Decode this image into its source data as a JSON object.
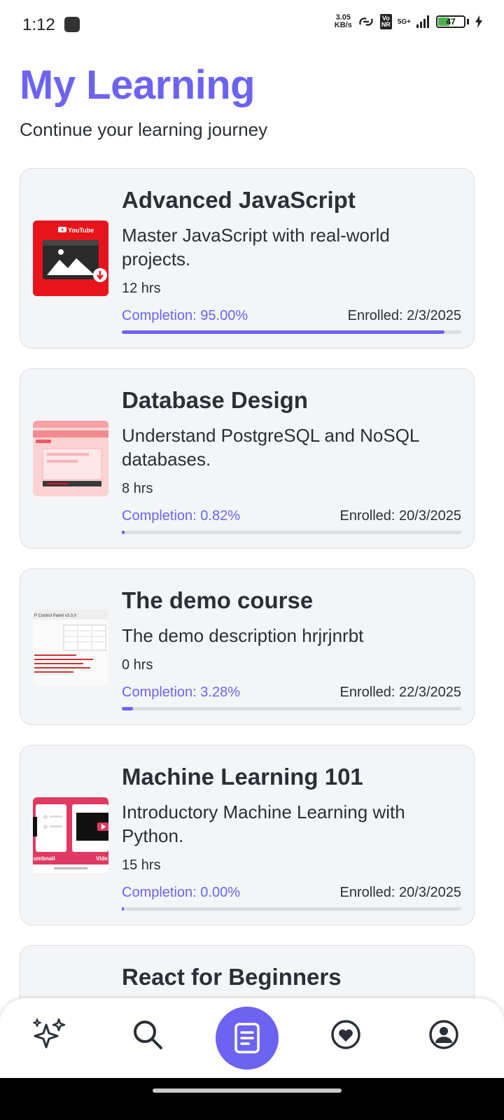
{
  "status_bar": {
    "time": "1:12",
    "net_speed_value": "3.05",
    "net_speed_unit": "KB/s",
    "volte_top": "Vo",
    "volte_bottom": "NR",
    "network": "5G+",
    "battery": "47",
    "battery_level": 0.47,
    "icons": [
      "notification-square-icon",
      "hotspot-icon",
      "signal-icon",
      "battery-icon",
      "charging-bolt-icon"
    ]
  },
  "header": {
    "title": "My Learning",
    "subtitle": "Continue your learning journey"
  },
  "colors": {
    "accent": "#6c63f2",
    "card_bg": "#f4f5f7",
    "text": "#2b2f36",
    "track": "#dcdee2"
  },
  "courses": [
    {
      "title": "Advanced JavaScript",
      "description": "Master JavaScript with real-world projects.",
      "hours": "12 hrs",
      "completion_label": "Completion: 95.00%",
      "completion": 95.0,
      "enrolled": "Enrolled: 2/3/2025",
      "thumb_label": "YouTube"
    },
    {
      "title": "Database Design",
      "description": "Understand PostgreSQL and NoSQL databases.",
      "hours": "8 hrs",
      "completion_label": "Completion: 0.82%",
      "completion": 0.82,
      "enrolled": "Enrolled: 20/3/2025"
    },
    {
      "title": "The demo course",
      "description": "The demo description hrjrjnrbt",
      "hours": "0 hrs",
      "completion_label": "Completion: 3.28%",
      "completion": 3.28,
      "enrolled": "Enrolled: 22/3/2025",
      "thumb_label": "P Control Panel v3.0.0"
    },
    {
      "title": "Machine Learning 101",
      "description": "Introductory Machine Learning with Python.",
      "hours": "15 hrs",
      "completion_label": "Completion: 0.00%",
      "completion": 0.0,
      "enrolled": "Enrolled: 20/3/2025",
      "thumb_label_left": "umbnail",
      "thumb_label_right": "Vide"
    },
    {
      "title": "React for Beginners"
    }
  ],
  "bottom_nav": {
    "items": [
      "sparkles-icon",
      "search-icon",
      "document-icon",
      "heart-icon",
      "profile-icon"
    ],
    "active": "document-icon"
  }
}
